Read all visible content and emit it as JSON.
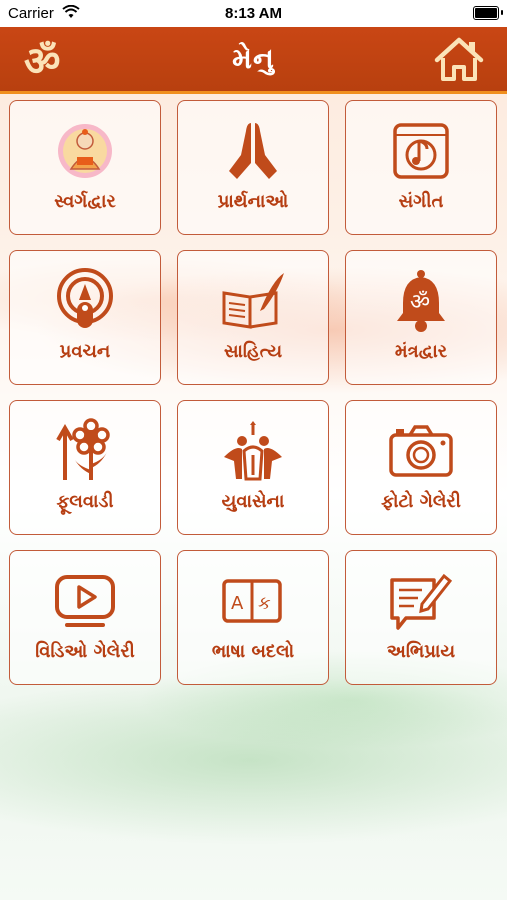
{
  "status_bar": {
    "carrier": "Carrier",
    "time": "8:13 AM"
  },
  "header": {
    "title": "મેનુ",
    "left_icon": "om-icon",
    "right_icon": "home-icon"
  },
  "colors": {
    "primary": "#bf4412",
    "accent": "#f08f1e",
    "tile_border": "#c25b3a"
  },
  "menu": {
    "items": [
      {
        "label": "સ્વર્ગદ્વાર",
        "icon": "temple-deity-icon"
      },
      {
        "label": "પ્રાર્થનાઓ",
        "icon": "folded-hands-icon"
      },
      {
        "label": "સંગીત",
        "icon": "music-icon"
      },
      {
        "label": "પ્રવચન",
        "icon": "podcast-icon"
      },
      {
        "label": "સાહિત્ય",
        "icon": "book-quill-icon"
      },
      {
        "label": "મંત્રદ્વાર",
        "icon": "om-bell-icon"
      },
      {
        "label": "ફૂલવાડી",
        "icon": "flower-growth-icon"
      },
      {
        "label": "યુવાસેના",
        "icon": "youth-group-icon"
      },
      {
        "label": "ફોટો ગેલેરી",
        "icon": "camera-icon"
      },
      {
        "label": "વિડિઓ ગેલેરી",
        "icon": "video-play-icon"
      },
      {
        "label": "ભાષા બદલો",
        "icon": "language-icon"
      },
      {
        "label": "અભિપ્રાય",
        "icon": "feedback-icon"
      }
    ]
  }
}
